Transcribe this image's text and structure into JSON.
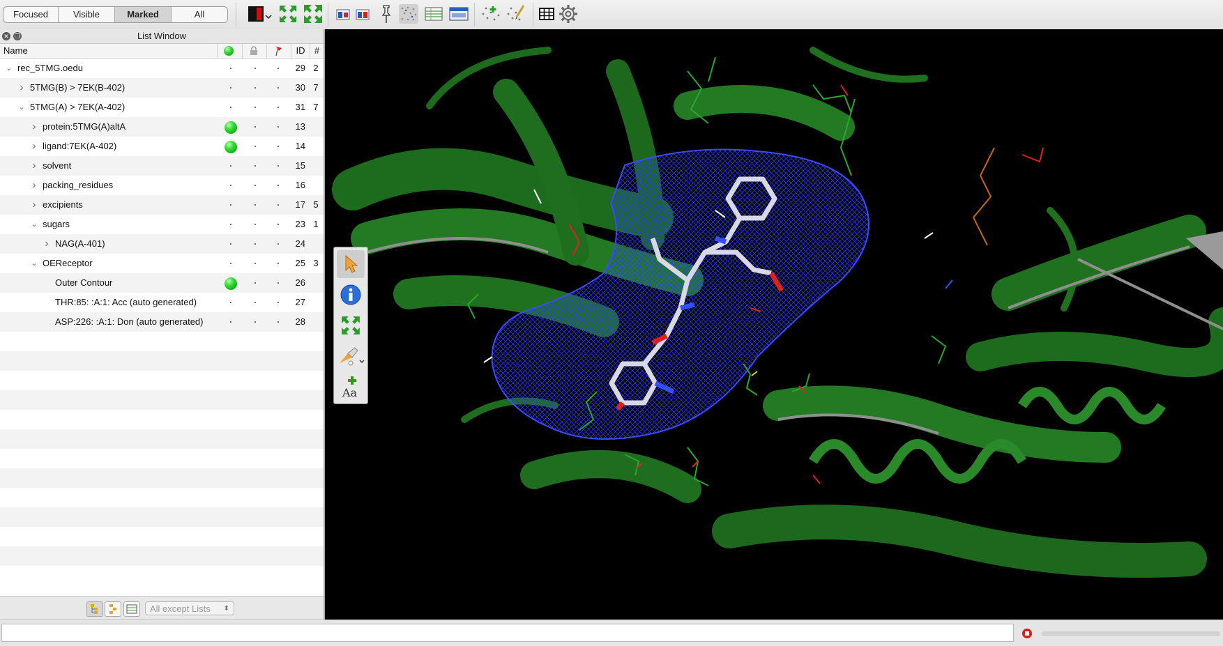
{
  "toolbar": {
    "segments": [
      {
        "label": "Focused",
        "active": false
      },
      {
        "label": "Visible",
        "active": false
      },
      {
        "label": "Marked",
        "active": true
      },
      {
        "label": "All",
        "active": false
      }
    ],
    "icons": [
      "color-scheme-icon",
      "fit-to-view-icon",
      "expand-view-icon",
      "view-mode-a-icon",
      "view-mode-b-icon",
      "pin-icon",
      "hydrogens-icon",
      "spreadsheet-icon",
      "grid-window-icon",
      "add-atoms-icon",
      "measure-icon",
      "table-icon",
      "settings-gear-icon"
    ]
  },
  "list_window": {
    "title": "List Window",
    "columns": {
      "name": "Name",
      "id": "ID",
      "count": "#"
    },
    "rows": [
      {
        "name": "rec_5TMG.oedu",
        "indent": 0,
        "chevron": "down",
        "visible": false,
        "id": "29",
        "count": "2"
      },
      {
        "name": "5TMG(B) > 7EK(B-402)",
        "indent": 1,
        "chevron": "right",
        "visible": false,
        "id": "30",
        "count": "7"
      },
      {
        "name": "5TMG(A) > 7EK(A-402)",
        "indent": 1,
        "chevron": "down",
        "visible": false,
        "id": "31",
        "count": "7"
      },
      {
        "name": "protein:5TMG(A)altA",
        "indent": 2,
        "chevron": "right",
        "visible": true,
        "id": "13",
        "count": ""
      },
      {
        "name": "ligand:7EK(A-402)",
        "indent": 2,
        "chevron": "right",
        "visible": true,
        "id": "14",
        "count": ""
      },
      {
        "name": "solvent",
        "indent": 2,
        "chevron": "right",
        "visible": false,
        "id": "15",
        "count": ""
      },
      {
        "name": "packing_residues",
        "indent": 2,
        "chevron": "right",
        "visible": false,
        "id": "16",
        "count": ""
      },
      {
        "name": "excipients",
        "indent": 2,
        "chevron": "right",
        "visible": false,
        "id": "17",
        "count": "5"
      },
      {
        "name": "sugars",
        "indent": 2,
        "chevron": "down",
        "visible": false,
        "id": "23",
        "count": "1"
      },
      {
        "name": "NAG(A-401)",
        "indent": 3,
        "chevron": "right",
        "visible": false,
        "id": "24",
        "count": ""
      },
      {
        "name": "OEReceptor",
        "indent": 2,
        "chevron": "down",
        "visible": false,
        "id": "25",
        "count": "3"
      },
      {
        "name": "Outer Contour",
        "indent": 3,
        "chevron": "",
        "visible": true,
        "id": "26",
        "count": ""
      },
      {
        "name": "THR:85: :A:1:  Acc (auto generated)",
        "indent": 3,
        "chevron": "",
        "visible": false,
        "id": "27",
        "count": ""
      },
      {
        "name": "ASP:226: :A:1:  Don (auto generated)",
        "indent": 3,
        "chevron": "",
        "visible": false,
        "id": "28",
        "count": ""
      }
    ],
    "filter": {
      "value": "All except Lists"
    }
  },
  "palette": {
    "tools": [
      "pointer-arrow-icon",
      "info-icon",
      "center-view-icon",
      "paint-brush-icon",
      "add-label-icon"
    ]
  },
  "colors": {
    "ribbon": "#1f7a1f",
    "surface_mesh": "#2233ff",
    "viewport_bg": "#000000",
    "visible_dot": "#2fd12f"
  }
}
